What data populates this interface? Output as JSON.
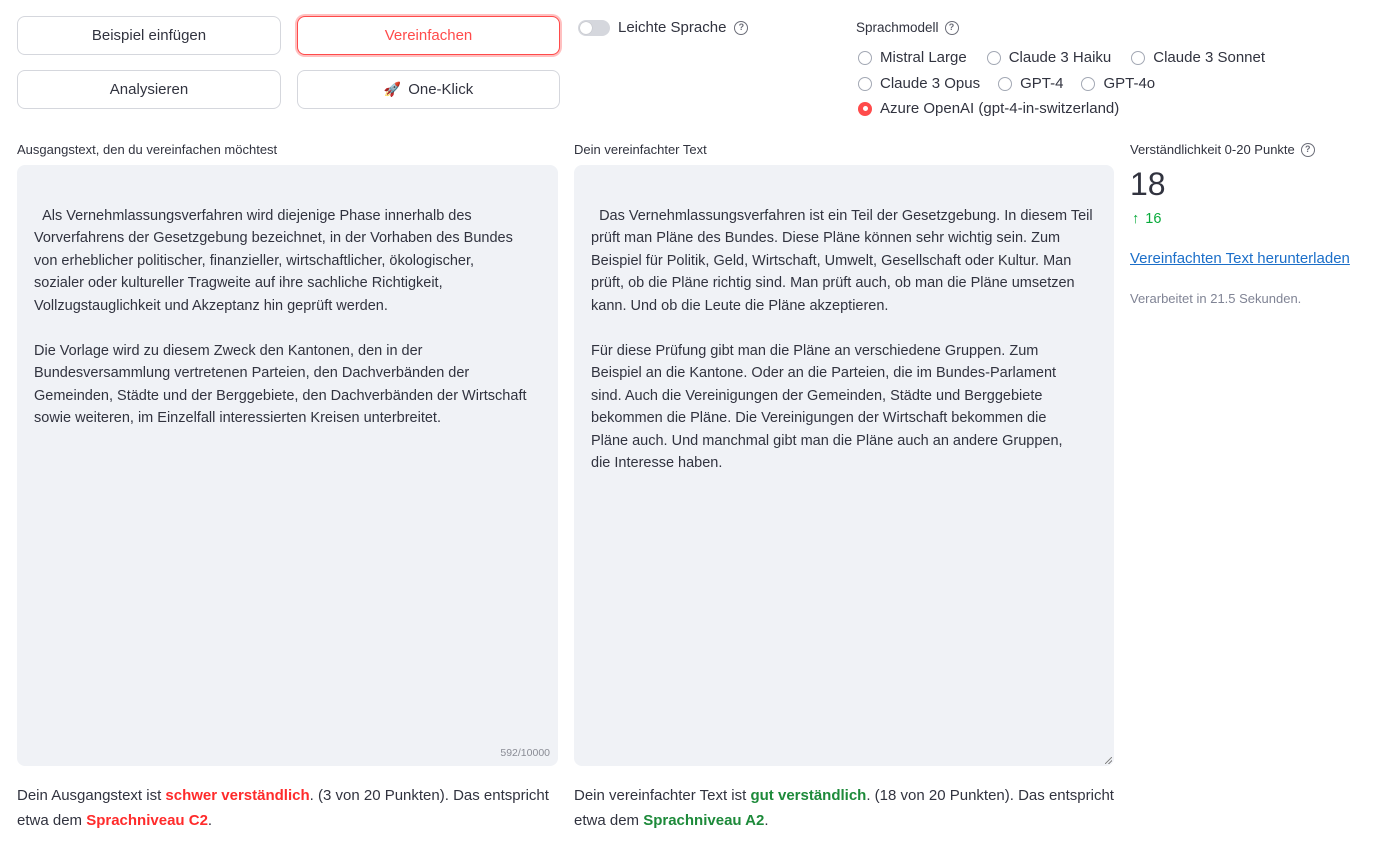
{
  "buttons": {
    "example": "Beispiel einfügen",
    "simplify": "Vereinfachen",
    "analyze": "Analysieren",
    "oneclick_icon": "🚀",
    "oneclick": "One-Klick"
  },
  "toggle": {
    "label": "Leichte Sprache",
    "checked": false
  },
  "models": {
    "title": "Sprachmodell",
    "options": [
      {
        "label": "Mistral Large",
        "selected": false
      },
      {
        "label": "Claude 3 Haiku",
        "selected": false
      },
      {
        "label": "Claude 3 Sonnet",
        "selected": false
      },
      {
        "label": "Claude 3 Opus",
        "selected": false
      },
      {
        "label": "GPT-4",
        "selected": false
      },
      {
        "label": "GPT-4o",
        "selected": false
      },
      {
        "label": "Azure OpenAI (gpt-4-in-switzerland)",
        "selected": true
      }
    ]
  },
  "source": {
    "label": "Ausgangstext, den du vereinfachen möchtest",
    "text": "Als Vernehmlassungsverfahren wird diejenige Phase innerhalb des\nVorverfahrens der Gesetzgebung bezeichnet, in der Vorhaben des Bundes\nvon erheblicher politischer, finanzieller, wirtschaftlicher, ökologischer,\nsozialer oder kultureller Tragweite auf ihre sachliche Richtigkeit,\nVollzugstauglichkeit und Akzeptanz hin geprüft werden.\n\nDie Vorlage wird zu diesem Zweck den Kantonen, den in der\nBundesversammlung vertretenen Parteien, den Dachverbänden der\nGemeinden, Städte und der Berggebiete, den Dachverbänden der Wirtschaft\nsowie weiteren, im Einzelfall interessierten Kreisen unterbreitet.",
    "counter": "592/10000"
  },
  "simplified": {
    "label": "Dein vereinfachter Text",
    "text": "Das Vernehmlassungsverfahren ist ein Teil der Gesetzgebung. In diesem Teil\nprüft man Pläne des Bundes. Diese Pläne können sehr wichtig sein. Zum\nBeispiel für Politik, Geld, Wirtschaft, Umwelt, Gesellschaft oder Kultur. Man\nprüft, ob die Pläne richtig sind. Man prüft auch, ob man die Pläne umsetzen\nkann. Und ob die Leute die Pläne akzeptieren.\n\nFür diese Prüfung gibt man die Pläne an verschiedene Gruppen. Zum\nBeispiel an die Kantone. Oder an die Parteien, die im Bundes-Parlament\nsind. Auch die Vereinigungen der Gemeinden, Städte und Berggebiete\nbekommen die Pläne. Die Vereinigungen der Wirtschaft bekommen die\nPläne auch. Und manchmal gibt man die Pläne auch an andere Gruppen,\ndie Interesse haben."
  },
  "metric": {
    "label": "Verständlichkeit 0-20 Punkte",
    "value": "18",
    "delta_icon": "↑",
    "delta": "16",
    "delta_color": "#09ab3b"
  },
  "download_link": "Vereinfachten Text herunterladen",
  "processed": "Verarbeitet in 21.5 Sekunden.",
  "result_source": {
    "p1": "Dein Ausgangstext ist ",
    "rating": "schwer verständlich",
    "p2": ". (3 von 20 Punkten). Das entspricht etwa dem ",
    "level": "Sprachniveau C2",
    "p3": ".",
    "color": "#ff2b2b"
  },
  "result_simplified": {
    "p1": "Dein vereinfachter Text ist ",
    "rating": "gut verständlich",
    "p2": ". (18 von 20 Punkten). Das entspricht etwa dem ",
    "level": "Sprachniveau A2",
    "p3": ".",
    "color": "#1d8a3a"
  }
}
